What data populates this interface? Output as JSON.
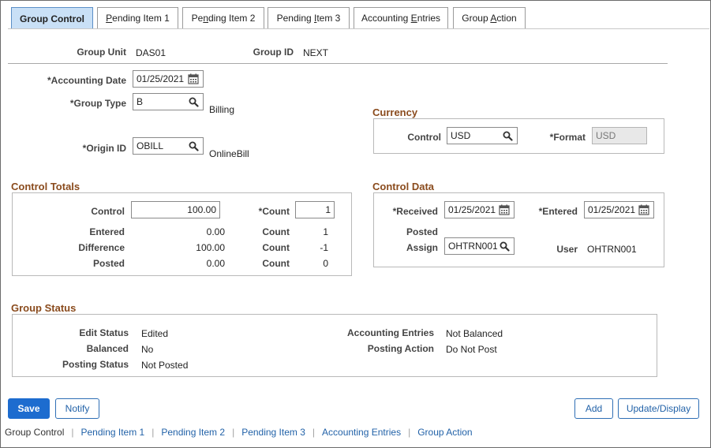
{
  "tabs": [
    {
      "label": "Group Control",
      "active": true
    },
    {
      "label": "Pending Item 1"
    },
    {
      "label": "Pending Item 2"
    },
    {
      "label": "Pending Item 3"
    },
    {
      "label": "Accounting Entries"
    },
    {
      "label": "Group Action"
    }
  ],
  "header": {
    "group_unit_label": "Group Unit",
    "group_unit_value": "DAS01",
    "group_id_label": "Group ID",
    "group_id_value": "NEXT"
  },
  "form": {
    "accounting_date_label": "*Accounting Date",
    "accounting_date_value": "01/25/2021",
    "group_type_label": "*Group Type",
    "group_type_value": "B",
    "group_type_desc": "Billing",
    "origin_id_label": "*Origin ID",
    "origin_id_value": "OBILL",
    "origin_id_desc": "OnlineBill"
  },
  "currency": {
    "title": "Currency",
    "control_label": "Control",
    "control_value": "USD",
    "format_label": "*Format",
    "format_value": "USD"
  },
  "control_totals": {
    "title": "Control Totals",
    "control_label": "Control",
    "control_value": "100.00",
    "count_label": "*Count",
    "count_value": "1",
    "entered_label": "Entered",
    "entered_value": "0.00",
    "entered_count_label": "Count",
    "entered_count_value": "1",
    "difference_label": "Difference",
    "difference_value": "100.00",
    "difference_count_label": "Count",
    "difference_count_value": "-1",
    "posted_label": "Posted",
    "posted_value": "0.00",
    "posted_count_label": "Count",
    "posted_count_value": "0"
  },
  "control_data": {
    "title": "Control Data",
    "received_label": "*Received",
    "received_value": "01/25/2021",
    "entered_label": "*Entered",
    "entered_value": "01/25/2021",
    "posted_label": "Posted",
    "assign_label": "Assign",
    "assign_value": "OHTRN001",
    "user_label": "User",
    "user_value": "OHTRN001"
  },
  "group_status": {
    "title": "Group Status",
    "edit_status_label": "Edit Status",
    "edit_status_value": "Edited",
    "balanced_label": "Balanced",
    "balanced_value": "No",
    "posting_status_label": "Posting Status",
    "posting_status_value": "Not Posted",
    "accounting_entries_label": "Accounting Entries",
    "accounting_entries_value": "Not Balanced",
    "posting_action_label": "Posting Action",
    "posting_action_value": "Do Not Post"
  },
  "buttons": {
    "save": "Save",
    "notify": "Notify",
    "add": "Add",
    "update_display": "Update/Display"
  },
  "bottom_links": [
    {
      "label": "Group Control",
      "current": true
    },
    {
      "label": "Pending Item 1"
    },
    {
      "label": "Pending Item 2"
    },
    {
      "label": "Pending Item 3"
    },
    {
      "label": "Accounting Entries"
    },
    {
      "label": "Group Action"
    }
  ],
  "icons": {
    "calendar": "calendar-icon",
    "search": "search-icon"
  },
  "colors": {
    "primary": "#1d6ccf",
    "section_title": "#8a4b1d",
    "active_tab": "#c9e0f6"
  }
}
